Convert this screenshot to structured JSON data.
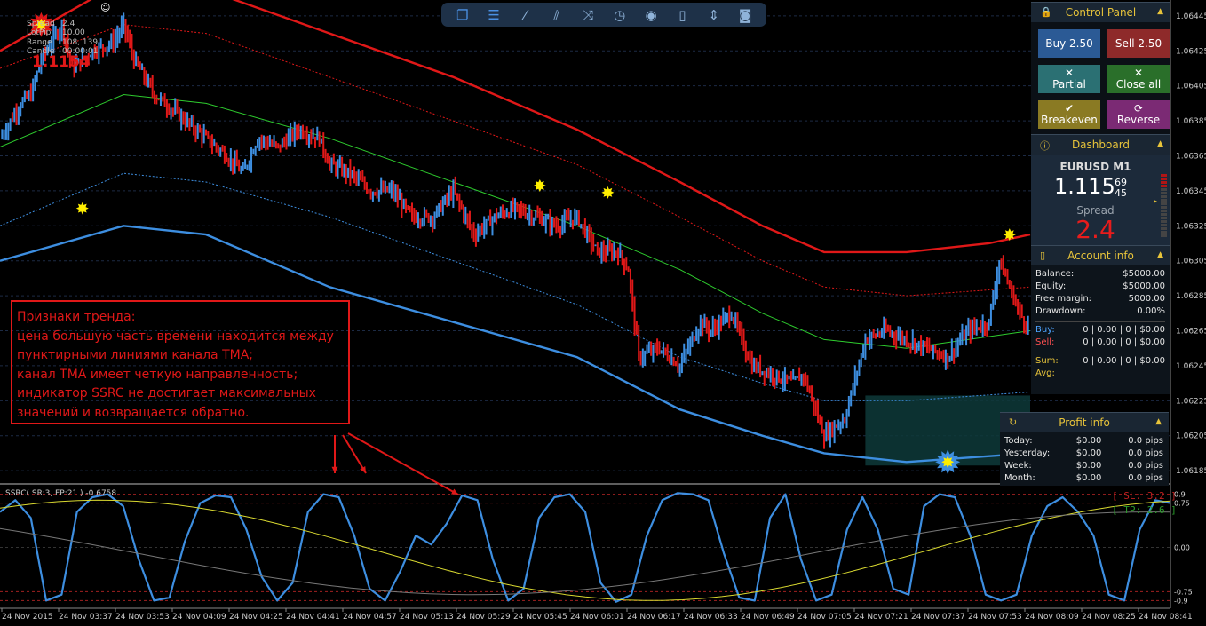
{
  "toolbar": {
    "icons": [
      "windows-icon",
      "list-icon",
      "trendline-icon",
      "parallel-lines-icon",
      "shuffle-icon",
      "clock-icon",
      "eye-icon",
      "trash-icon",
      "horizontal-line-icon",
      "camera-icon"
    ]
  },
  "info": {
    "rows": [
      [
        "Spread",
        "2.4"
      ],
      [
        "LotPip",
        "10.00"
      ],
      [
        "Range",
        "108, 139"
      ],
      [
        "Candle",
        "00:00:01"
      ]
    ],
    "price": "1.1154",
    "smiley": "☺"
  },
  "control_panel": {
    "title": "Control Panel",
    "buttons": [
      {
        "icon": "",
        "label": "Buy 2.50",
        "color": "#2b5a95"
      },
      {
        "icon": "",
        "label": "Sell 2.50",
        "color": "#8e2a2a"
      },
      {
        "icon": "✕",
        "label": "Partial",
        "color": "#2b7073"
      },
      {
        "icon": "✕",
        "label": "Close all",
        "color": "#2a6f2a"
      },
      {
        "icon": "✔",
        "label": "Breakeven",
        "color": "#8a7a23"
      },
      {
        "icon": "⟳",
        "label": "Reverse",
        "color": "#7b2a74"
      }
    ]
  },
  "dashboard": {
    "title": "Dashboard",
    "symbol": "EURUSD M1",
    "price_main": "1.115",
    "price_sup": "69",
    "price_sub": "45",
    "spread_label": "Spread",
    "spread_value": "2.4"
  },
  "account": {
    "title": "Account info",
    "rows": [
      [
        "Balance:",
        "$5000.00"
      ],
      [
        "Equity:",
        "$5000.00"
      ],
      [
        "Free margin:",
        "5000.00"
      ],
      [
        "Drawdown:",
        "0.00%"
      ]
    ],
    "buy_label": "Buy:",
    "buy_value": "0 | 0.00 | 0 | $0.00",
    "sell_label": "Sell:",
    "sell_value": "0 | 0.00 | 0 | $0.00",
    "sum_label": "Sum:",
    "sum_value": "0 | 0.00 | 0 | $0.00",
    "avg_label": "Avg:"
  },
  "profit": {
    "title": "Profit info",
    "rows": [
      [
        "Today:",
        "$0.00",
        "0.0 pips"
      ],
      [
        "Yesterday:",
        "$0.00",
        "0.0 pips"
      ],
      [
        "Week:",
        "$0.00",
        "0.0 pips"
      ],
      [
        "Month:",
        "$0.00",
        "0.0 pips"
      ]
    ]
  },
  "annotation": {
    "lines": [
      "Признаки тренда:",
      "цена большую часть времени находится между",
      "пунктирными линиями канала ТМА;",
      "канал ТМА имеет четкую направленность;",
      "индикатор SSRC не достигает максимальных",
      "значений и возвращается обратно."
    ]
  },
  "indicator": {
    "title": "SSRC( SR:3, FP:21 ) -0.6758",
    "sl": "[ SL: 3.2 ]",
    "tp": "[ TP: 2.6 ]",
    "levels": [
      "0.9",
      "0.75",
      "0.00",
      "-0.75",
      "-0.9"
    ]
  },
  "colors": {
    "up": "#3d8ee0",
    "down": "#e01818",
    "tma_mid": "#2ecc2e",
    "band_outer_up": "#e01818",
    "band_outer_dn": "#3d8ee0",
    "ssrc": "#3d8ee0"
  },
  "chart_data": {
    "type": "bar",
    "symbol": "EURUSD",
    "timeframe": "M1",
    "y_ticks": [
      "1.06445",
      "1.06425",
      "1.06405",
      "1.06385",
      "1.06365",
      "1.06345",
      "1.06325",
      "1.06305",
      "1.06285",
      "1.06265",
      "1.06245",
      "1.06225",
      "1.06205",
      "1.06185"
    ],
    "y_range": [
      1.0618,
      1.0645
    ],
    "x_ticks": [
      "24 Nov 2015",
      "24 Nov 03:37",
      "24 Nov 03:53",
      "24 Nov 04:09",
      "24 Nov 04:25",
      "24 Nov 04:41",
      "24 Nov 04:57",
      "24 Nov 05:13",
      "24 Nov 05:29",
      "24 Nov 05:45",
      "24 Nov 06:01",
      "24 Nov 06:17",
      "24 Nov 06:33",
      "24 Nov 06:49",
      "24 Nov 07:05",
      "24 Nov 07:21",
      "24 Nov 07:37",
      "24 Nov 07:53",
      "24 Nov 08:09",
      "24 Nov 08:25",
      "24 Nov 08:41"
    ],
    "price_path": [
      [
        0,
        1.06375
      ],
      [
        5,
        1.06385
      ],
      [
        10,
        1.06395
      ],
      [
        15,
        1.064
      ],
      [
        20,
        1.0642
      ],
      [
        25,
        1.0643
      ],
      [
        30,
        1.0644
      ],
      [
        35,
        1.06415
      ],
      [
        40,
        1.0642
      ],
      [
        45,
        1.06425
      ],
      [
        55,
        1.0643
      ],
      [
        60,
        1.0644
      ],
      [
        65,
        1.0642
      ],
      [
        70,
        1.0641
      ],
      [
        75,
        1.064
      ],
      [
        80,
        1.06395
      ],
      [
        90,
        1.06385
      ],
      [
        100,
        1.06375
      ],
      [
        110,
        1.06365
      ],
      [
        118,
        1.06355
      ],
      [
        125,
        1.06375
      ],
      [
        135,
        1.0637
      ],
      [
        145,
        1.0638
      ],
      [
        155,
        1.06375
      ],
      [
        160,
        1.0636
      ],
      [
        170,
        1.06355
      ],
      [
        180,
        1.06345
      ],
      [
        190,
        1.06345
      ],
      [
        200,
        1.0633
      ],
      [
        210,
        1.0633
      ],
      [
        220,
        1.06345
      ],
      [
        230,
        1.0632
      ],
      [
        240,
        1.0633
      ],
      [
        250,
        1.06335
      ],
      [
        260,
        1.0633
      ],
      [
        270,
        1.06325
      ],
      [
        280,
        1.0633
      ],
      [
        290,
        1.0631
      ],
      [
        300,
        1.0631
      ],
      [
        305,
        1.063
      ],
      [
        310,
        1.0625
      ],
      [
        320,
        1.06255
      ],
      [
        330,
        1.06245
      ],
      [
        340,
        1.0627
      ],
      [
        345,
        1.06265
      ],
      [
        355,
        1.06275
      ],
      [
        365,
        1.06245
      ],
      [
        375,
        1.0624
      ],
      [
        385,
        1.06235
      ],
      [
        390,
        1.0624
      ],
      [
        400,
        1.06205
      ],
      [
        410,
        1.06215
      ],
      [
        420,
        1.0626
      ],
      [
        430,
        1.06265
      ],
      [
        440,
        1.0626
      ],
      [
        450,
        1.06255
      ],
      [
        460,
        1.0625
      ],
      [
        470,
        1.06265
      ],
      [
        480,
        1.0627
      ],
      [
        485,
        1.06305
      ],
      [
        490,
        1.0629
      ],
      [
        495,
        1.06275
      ],
      [
        500,
        1.06265
      ]
    ],
    "tma_mid": [
      [
        0,
        1.0637
      ],
      [
        60,
        1.064
      ],
      [
        100,
        1.06395
      ],
      [
        160,
        1.06375
      ],
      [
        220,
        1.0635
      ],
      [
        280,
        1.06325
      ],
      [
        330,
        1.063
      ],
      [
        370,
        1.06275
      ],
      [
        400,
        1.0626
      ],
      [
        440,
        1.06255
      ],
      [
        500,
        1.06265
      ]
    ],
    "tma_upper_dash": [
      [
        0,
        1.06415
      ],
      [
        60,
        1.0644
      ],
      [
        100,
        1.06435
      ],
      [
        160,
        1.0641
      ],
      [
        220,
        1.06385
      ],
      [
        280,
        1.0636
      ],
      [
        330,
        1.0633
      ],
      [
        370,
        1.06305
      ],
      [
        400,
        1.0629
      ],
      [
        440,
        1.06285
      ],
      [
        500,
        1.0629
      ]
    ],
    "tma_lower_dash": [
      [
        0,
        1.06325
      ],
      [
        60,
        1.06355
      ],
      [
        100,
        1.0635
      ],
      [
        160,
        1.0633
      ],
      [
        220,
        1.06305
      ],
      [
        280,
        1.0628
      ],
      [
        330,
        1.0625
      ],
      [
        370,
        1.06235
      ],
      [
        400,
        1.06225
      ],
      [
        440,
        1.06225
      ],
      [
        500,
        1.0623
      ]
    ],
    "band_upper": [
      [
        0,
        1.06425
      ],
      [
        60,
        1.06465
      ],
      [
        100,
        1.0646
      ],
      [
        160,
        1.06435
      ],
      [
        220,
        1.0641
      ],
      [
        280,
        1.0638
      ],
      [
        330,
        1.0635
      ],
      [
        370,
        1.06325
      ],
      [
        400,
        1.0631
      ],
      [
        440,
        1.0631
      ],
      [
        480,
        1.06315
      ],
      [
        500,
        1.0632
      ]
    ],
    "band_lower": [
      [
        0,
        1.06305
      ],
      [
        60,
        1.06325
      ],
      [
        100,
        1.0632
      ],
      [
        160,
        1.0629
      ],
      [
        220,
        1.0627
      ],
      [
        280,
        1.0625
      ],
      [
        330,
        1.0622
      ],
      [
        370,
        1.06205
      ],
      [
        400,
        1.06195
      ],
      [
        440,
        1.0619
      ],
      [
        500,
        1.06195
      ]
    ],
    "signals_sell": [
      [
        20,
        1.0644
      ],
      [
        295,
        1.06344
      ],
      [
        490,
        1.0632
      ]
    ],
    "signals_buy": [
      [
        40,
        1.06335
      ],
      [
        262,
        1.06348
      ],
      [
        460,
        1.0619
      ]
    ],
    "ssrc": [
      0.6,
      0.8,
      0.5,
      -0.9,
      -0.8,
      0.6,
      0.85,
      0.9,
      0.7,
      -0.2,
      -0.9,
      -0.85,
      0.1,
      0.75,
      0.88,
      0.85,
      0.3,
      -0.5,
      -0.9,
      -0.6,
      0.6,
      0.9,
      0.85,
      0.2,
      -0.7,
      -0.9,
      -0.4,
      0.2,
      0.05,
      0.4,
      0.88,
      0.8,
      -0.2,
      -0.9,
      -0.7,
      0.5,
      0.85,
      0.9,
      0.6,
      -0.6,
      -0.92,
      -0.8,
      0.2,
      0.8,
      0.92,
      0.9,
      0.8,
      -0.1,
      -0.85,
      -0.9,
      0.5,
      0.9,
      -0.2,
      -0.9,
      -0.8,
      0.3,
      0.85,
      0.3,
      -0.7,
      -0.8,
      0.7,
      0.9,
      0.85,
      0.2,
      -0.8,
      -0.9,
      -0.8,
      0.2,
      0.7,
      0.85,
      0.6,
      0.2,
      -0.8,
      -0.9,
      0.3,
      0.8,
      0.75
    ],
    "ssrc_range": [
      -1,
      1
    ]
  }
}
